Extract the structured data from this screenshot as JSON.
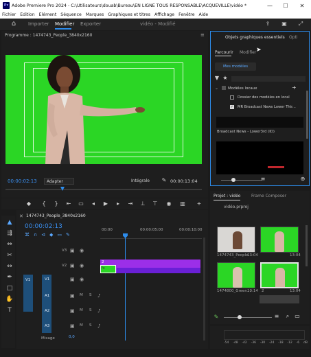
{
  "titlebar": {
    "app_abbr": "Pr",
    "title": "Adobe Premiere Pro 2024 - C:\\Utilisateurs\\douab\\Bureau\\EN LIGNE TOUS RESPONSABLE\\ACQUEVILLE\\vidéo *",
    "minimize": "—",
    "maximize": "☐",
    "close": "✕"
  },
  "menu": [
    "Fichier",
    "Edition",
    "Elément",
    "Séquence",
    "Marques",
    "Graphiques et titres",
    "Affichage",
    "Fenêtre",
    "Aide"
  ],
  "workspace": {
    "home": "⌂",
    "tabs": [
      "Importer",
      "Modifier",
      "Exporter"
    ],
    "active_tab": "Modifier",
    "center_title": "vidéo - Modifié"
  },
  "program": {
    "title": "Programme : 1474743_People_3840x2160",
    "timecode": "00:00:02:13",
    "fit": "Adapter",
    "quality": "Intégrale",
    "duration": "00:00:13:04"
  },
  "egp": {
    "tab": "Objets graphiques essentiels",
    "tab2": "Opti",
    "subtabs": [
      "Parcourir",
      "Modifier"
    ],
    "active_subtab": "Parcourir",
    "my_templates": "Mes modèles",
    "tree": [
      "Modèles locaux",
      "Dossier des modèles en local",
      "MR Broadcast News Lower Thir..."
    ],
    "thumb_label": "Broadcast News - Lower3rd (ID)"
  },
  "timeline": {
    "seq_name": "1474743_People_3840x2160",
    "timecode": "00:00:02:13",
    "ruler": [
      "00:00",
      "00:00:05:00",
      "00:00:10:00"
    ],
    "video_tracks": [
      "V3",
      "V2",
      "V1"
    ],
    "audio_tracks": [
      "A1",
      "A2",
      "A3"
    ],
    "src_v": "V1",
    "src_a": "A1",
    "clip_top_badge": "2",
    "clip_bottom_badge": "fx",
    "mix_label": "Mixage",
    "mix_value": "0,0"
  },
  "project": {
    "tab": "Projet : vidéo",
    "tab2": "Frame Composer",
    "file": "vidéo.prproj",
    "items": [
      {
        "name": "1474743_People...",
        "dur": "13:04"
      },
      {
        "name": "",
        "dur": "13:04"
      },
      {
        "name": "1474800_Green...",
        "dur": "10:14"
      },
      {
        "name": "2",
        "dur": "13:04"
      }
    ]
  },
  "audio_meter": {
    "scale": [
      "-54",
      "-48",
      "-42",
      "-36",
      "-30",
      "-24",
      "-18",
      "-12",
      "-6",
      "dB"
    ]
  },
  "colors": {
    "accent": "#2d8ceb",
    "clip_v2": "#9c2fe8",
    "clip_v1": "#6a20d6",
    "greenscreen": "#2bd625"
  }
}
